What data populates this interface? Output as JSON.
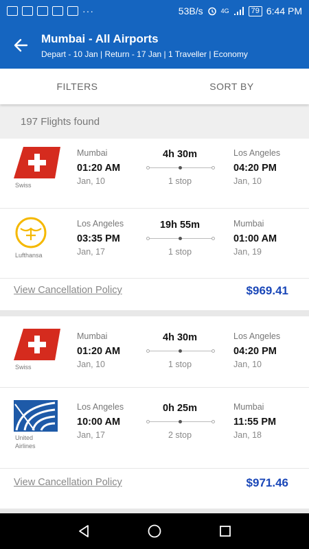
{
  "status_bar": {
    "speed": "53B/s",
    "network": "4G",
    "battery": "79",
    "time": "6:44 PM"
  },
  "header": {
    "title": "Mumbai - All Airports",
    "subtitle": "Depart - 10 Jan | Return - 17 Jan | 1 Traveller | Economy"
  },
  "tabs": {
    "filters": "FILTERS",
    "sort_by": "SORT BY"
  },
  "results": {
    "count_text": "197 Flights found"
  },
  "cards": [
    {
      "outbound": {
        "airline": "Swiss",
        "from_city": "Mumbai",
        "dep_time": "01:20 AM",
        "dep_date": "Jan, 10",
        "duration": "4h 30m",
        "stops": "1 stop",
        "to_city": "Los Angeles",
        "arr_time": "04:20 PM",
        "arr_date": "Jan, 10"
      },
      "return": {
        "airline": "Lufthansa",
        "from_city": "Los Angeles",
        "dep_time": "03:35 PM",
        "dep_date": "Jan, 17",
        "duration": "19h 55m",
        "stops": "1 stop",
        "to_city": "Mumbai",
        "arr_time": "01:00 AM",
        "arr_date": "Jan, 19"
      },
      "policy_link": "View Cancellation Policy",
      "price": "$969.41"
    },
    {
      "outbound": {
        "airline": "Swiss",
        "from_city": "Mumbai",
        "dep_time": "01:20 AM",
        "dep_date": "Jan, 10",
        "duration": "4h 30m",
        "stops": "1 stop",
        "to_city": "Los Angeles",
        "arr_time": "04:20 PM",
        "arr_date": "Jan, 10"
      },
      "return": {
        "airline_line1": "United",
        "airline_line2": "Airlines",
        "from_city": "Los Angeles",
        "dep_time": "10:00 AM",
        "dep_date": "Jan, 17",
        "duration": "0h 25m",
        "stops": "2 stop",
        "to_city": "Mumbai",
        "arr_time": "11:55 PM",
        "arr_date": "Jan, 18"
      },
      "policy_link": "View Cancellation Policy",
      "price": "$971.46"
    }
  ],
  "colors": {
    "primary": "#1565c0",
    "price": "#1a47b8",
    "swiss_red": "#d52b1e",
    "lufthansa_yellow": "#f5b800",
    "united_blue": "#1e5aa8"
  },
  "icons": [
    "back-arrow-icon",
    "nav-back-icon",
    "nav-home-icon",
    "nav-recents-icon"
  ]
}
